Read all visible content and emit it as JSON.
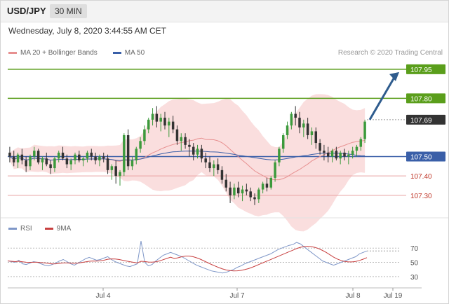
{
  "header": {
    "symbol": "USD/JPY",
    "timeframe": "30 MIN"
  },
  "datetime": "Wednesday, July 8, 2020 3:44:55 AM CET",
  "legend": {
    "ma20_label": "MA 20 + Bollinger Bands",
    "ma50_label": "MA 50",
    "credit": "Research © 2020 Trading Central"
  },
  "colors": {
    "bull": "#3c9a3c",
    "bear": "#333333",
    "target": "#5a9e1b",
    "support": "#3a5fa8",
    "resistance_lo": "#e8a0a0",
    "band": "#f8d3d3",
    "ma20": "#e79090",
    "ma50": "#3a5fa8",
    "arrow": "#2f5c8e",
    "current": "#333333"
  },
  "price_levels": [
    {
      "name": "target-107-95",
      "value": 107.95,
      "label": "107.95",
      "kind": "target"
    },
    {
      "name": "target-107-80",
      "value": 107.8,
      "label": "107.80",
      "kind": "target"
    },
    {
      "name": "support-107-50",
      "value": 107.5,
      "label": "107.50",
      "kind": "support"
    },
    {
      "name": "level-107-40",
      "value": 107.4,
      "label": "107.40",
      "kind": "minor"
    },
    {
      "name": "level-107-30",
      "value": 107.3,
      "label": "107.30",
      "kind": "minor"
    }
  ],
  "current_price": {
    "value": 107.69,
    "label": "107.69"
  },
  "rsi": {
    "label": "RSI",
    "ma_label": "9MA",
    "levels": [
      {
        "value": 70,
        "label": "70"
      },
      {
        "value": 50,
        "label": "50"
      },
      {
        "value": 30,
        "label": "30"
      }
    ],
    "values": [
      52,
      51,
      50,
      53,
      48,
      47,
      49,
      51,
      50,
      48,
      46,
      45,
      47,
      49,
      52,
      54,
      51,
      48,
      46,
      49,
      52,
      55,
      57,
      55,
      53,
      54,
      56,
      58,
      54,
      51,
      49,
      47,
      45,
      44,
      46,
      48,
      80,
      50,
      45,
      47,
      52,
      56,
      60,
      62,
      64,
      62,
      60,
      58,
      55,
      52,
      49,
      46,
      44,
      42,
      40,
      38,
      37,
      36,
      35,
      36,
      38,
      40,
      43,
      45,
      48,
      50,
      52,
      54,
      56,
      58,
      60,
      62,
      65,
      68,
      70,
      72,
      74,
      75,
      78,
      76,
      72,
      68,
      64,
      60,
      56,
      52,
      50,
      48,
      46,
      48,
      50,
      52,
      54,
      56,
      58,
      62,
      64,
      66
    ]
  },
  "x_axis": {
    "labels": [
      {
        "name": "jul-4",
        "text": "Jul 4"
      },
      {
        "name": "jul-7",
        "text": "Jul 7"
      },
      {
        "name": "jul-8",
        "text": "Jul 8"
      },
      {
        "name": "jul-19",
        "text": "Jul 19"
      }
    ]
  },
  "chart_data": {
    "type": "candlestick",
    "symbol": "USD/JPY",
    "interval": "30 MIN",
    "ylim": [
      107.22,
      108.0
    ],
    "ohlc": [
      [
        107.52,
        107.55,
        107.47,
        107.5
      ],
      [
        107.5,
        107.53,
        107.45,
        107.47
      ],
      [
        107.47,
        107.52,
        107.44,
        107.51
      ],
      [
        107.51,
        107.54,
        107.46,
        107.48
      ],
      [
        107.48,
        107.5,
        107.42,
        107.45
      ],
      [
        107.45,
        107.51,
        107.43,
        107.5
      ],
      [
        107.5,
        107.55,
        107.48,
        107.53
      ],
      [
        107.53,
        107.54,
        107.46,
        107.47
      ],
      [
        107.47,
        107.5,
        107.43,
        107.49
      ],
      [
        107.49,
        107.52,
        107.45,
        107.46
      ],
      [
        107.46,
        107.48,
        107.41,
        107.44
      ],
      [
        107.44,
        107.5,
        107.42,
        107.49
      ],
      [
        107.49,
        107.53,
        107.47,
        107.52
      ],
      [
        107.52,
        107.55,
        107.48,
        107.49
      ],
      [
        107.49,
        107.51,
        107.44,
        107.46
      ],
      [
        107.46,
        107.49,
        107.43,
        107.48
      ],
      [
        107.48,
        107.52,
        107.46,
        107.51
      ],
      [
        107.51,
        107.53,
        107.47,
        107.48
      ],
      [
        107.48,
        107.5,
        107.45,
        107.49
      ],
      [
        107.49,
        107.53,
        107.47,
        107.52
      ],
      [
        107.52,
        107.54,
        107.48,
        107.5
      ],
      [
        107.5,
        107.52,
        107.46,
        107.48
      ],
      [
        107.48,
        107.51,
        107.45,
        107.5
      ],
      [
        107.5,
        107.52,
        107.47,
        107.49
      ],
      [
        107.49,
        107.51,
        107.41,
        107.43
      ],
      [
        107.43,
        107.46,
        107.38,
        107.45
      ],
      [
        107.45,
        107.48,
        107.36,
        107.4
      ],
      [
        107.4,
        107.43,
        107.35,
        107.42
      ],
      [
        107.42,
        107.62,
        107.4,
        107.61
      ],
      [
        107.61,
        107.64,
        107.43,
        107.45
      ],
      [
        107.45,
        107.5,
        107.43,
        107.48
      ],
      [
        107.48,
        107.55,
        107.46,
        107.54
      ],
      [
        107.54,
        107.6,
        107.52,
        107.58
      ],
      [
        107.58,
        107.66,
        107.56,
        107.64
      ],
      [
        107.64,
        107.7,
        107.62,
        107.69
      ],
      [
        107.69,
        107.75,
        107.66,
        107.72
      ],
      [
        107.72,
        107.76,
        107.65,
        107.68
      ],
      [
        107.68,
        107.72,
        107.63,
        107.7
      ],
      [
        107.7,
        107.73,
        107.64,
        107.66
      ],
      [
        107.66,
        107.7,
        107.6,
        107.68
      ],
      [
        107.68,
        107.71,
        107.62,
        107.64
      ],
      [
        107.64,
        107.66,
        107.56,
        107.58
      ],
      [
        107.58,
        107.62,
        107.53,
        107.6
      ],
      [
        107.6,
        107.62,
        107.54,
        107.56
      ],
      [
        107.56,
        107.59,
        107.5,
        107.55
      ],
      [
        107.55,
        107.57,
        107.48,
        107.51
      ],
      [
        107.51,
        107.56,
        107.49,
        107.54
      ],
      [
        107.54,
        107.56,
        107.47,
        107.49
      ],
      [
        107.49,
        107.52,
        107.44,
        107.47
      ],
      [
        107.47,
        107.5,
        107.42,
        107.44
      ],
      [
        107.44,
        107.48,
        107.4,
        107.46
      ],
      [
        107.46,
        107.49,
        107.41,
        107.43
      ],
      [
        107.43,
        107.45,
        107.36,
        107.38
      ],
      [
        107.38,
        107.41,
        107.32,
        107.34
      ],
      [
        107.34,
        107.37,
        107.26,
        107.3
      ],
      [
        107.3,
        107.36,
        107.28,
        107.34
      ],
      [
        107.34,
        107.37,
        107.29,
        107.31
      ],
      [
        107.31,
        107.35,
        107.27,
        107.33
      ],
      [
        107.33,
        107.36,
        107.3,
        107.32
      ],
      [
        107.32,
        107.34,
        107.27,
        107.29
      ],
      [
        107.29,
        107.31,
        107.25,
        107.28
      ],
      [
        107.28,
        107.34,
        107.26,
        107.33
      ],
      [
        107.33,
        107.37,
        107.31,
        107.36
      ],
      [
        107.36,
        107.39,
        107.32,
        107.34
      ],
      [
        107.34,
        107.4,
        107.33,
        107.39
      ],
      [
        107.39,
        107.48,
        107.37,
        107.47
      ],
      [
        107.47,
        107.55,
        107.45,
        107.54
      ],
      [
        107.54,
        107.62,
        107.52,
        107.61
      ],
      [
        107.61,
        107.68,
        107.59,
        107.66
      ],
      [
        107.66,
        107.73,
        107.64,
        107.72
      ],
      [
        107.72,
        107.76,
        107.66,
        107.7
      ],
      [
        107.7,
        107.73,
        107.62,
        107.65
      ],
      [
        107.65,
        107.69,
        107.6,
        107.67
      ],
      [
        107.67,
        107.7,
        107.59,
        107.61
      ],
      [
        107.61,
        107.65,
        107.56,
        107.63
      ],
      [
        107.63,
        107.65,
        107.54,
        107.57
      ],
      [
        107.57,
        107.59,
        107.51,
        107.53
      ],
      [
        107.53,
        107.56,
        107.48,
        107.52
      ],
      [
        107.52,
        107.55,
        107.47,
        107.5
      ],
      [
        107.5,
        107.54,
        107.47,
        107.53
      ],
      [
        107.53,
        107.55,
        107.48,
        107.49
      ],
      [
        107.49,
        107.53,
        107.46,
        107.52
      ],
      [
        107.52,
        107.54,
        107.48,
        107.5
      ],
      [
        107.5,
        107.53,
        107.46,
        107.51
      ],
      [
        107.51,
        107.55,
        107.49,
        107.53
      ],
      [
        107.53,
        107.56,
        107.5,
        107.55
      ],
      [
        107.55,
        107.6,
        107.53,
        107.59
      ],
      [
        107.59,
        107.69,
        107.57,
        107.68
      ]
    ]
  }
}
